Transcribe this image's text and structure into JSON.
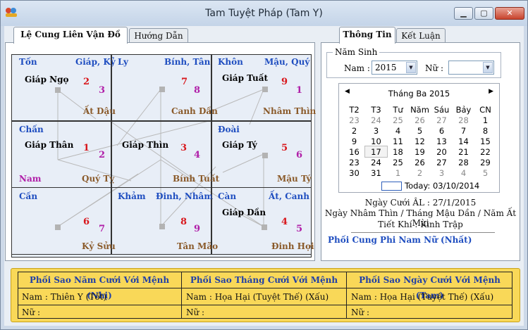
{
  "window": {
    "title": "Tam Tuyệt Pháp (Tam Y)"
  },
  "left_tabs": [
    {
      "label": "Lệ Cung Liên Vận Đồ"
    },
    {
      "label": "Hướng Dẫn"
    }
  ],
  "right_tabs": [
    {
      "label": "Thông Tin"
    },
    {
      "label": "Kết Luận"
    }
  ],
  "palaces": {
    "ton": {
      "name": "Tốn",
      "can": "Giáp, Kỷ",
      "gname": "Giáp Ngọ",
      "n1": "2",
      "n2": "3",
      "branch": "Ất Dậu"
    },
    "ly": {
      "name": "Ly",
      "can": "Bính, Tân",
      "gname": "",
      "n1": "7",
      "n2": "8",
      "branch": "Canh Dần"
    },
    "khon": {
      "name": "Khôn",
      "can": "Mậu, Quý",
      "gname": "Giáp Tuất",
      "n1": "9",
      "n2": "1",
      "branch": "Nhâm Thìn"
    },
    "chan": {
      "name": "Chấn",
      "can": "",
      "gname": "Giáp Thân",
      "n1": "1",
      "n2": "2",
      "branch": "Quý Tỵ",
      "extra": "Nam"
    },
    "center": {
      "name": "",
      "can": "",
      "gname": "Giáp Thìn",
      "n1": "3",
      "n2": "4",
      "branch": "Bính Tuất"
    },
    "doai": {
      "name": "Đoài",
      "can": "",
      "gname": "Giáp Tý",
      "n1": "5",
      "n2": "6",
      "branch": "Mậu Tý"
    },
    "can": {
      "name": "Cấn",
      "can": "",
      "gname": "",
      "n1": "6",
      "n2": "7",
      "branch": "Kỷ Sửu"
    },
    "kham": {
      "name": "Khảm",
      "can": "Đinh, Nhâm",
      "gname": "",
      "n1": "8",
      "n2": "9",
      "branch": "Tân Mão"
    },
    "canq": {
      "name": "Càn",
      "can": "Ất, Canh",
      "gname": "Giáp Dần",
      "n1": "4",
      "n2": "5",
      "branch": "Đinh Hợi"
    }
  },
  "birth": {
    "group_label": "Năm Sinh",
    "nam_label": "Nam :",
    "nam_value": "2015",
    "nu_label": "Nữ :",
    "nu_value": ""
  },
  "calendar": {
    "month_label": "Tháng Ba 2015",
    "weekdays": [
      "T2",
      "T3",
      "Tư",
      "Năm",
      "Sáu",
      "Bảy",
      "CN"
    ],
    "weeks": [
      [
        [
          "23",
          1
        ],
        [
          "24",
          1
        ],
        [
          "25",
          1
        ],
        [
          "26",
          1
        ],
        [
          "27",
          1
        ],
        [
          "28",
          1
        ],
        [
          "1",
          0
        ]
      ],
      [
        [
          "2",
          0
        ],
        [
          "3",
          0
        ],
        [
          "4",
          0
        ],
        [
          "5",
          0
        ],
        [
          "6",
          0
        ],
        [
          "7",
          0
        ],
        [
          "8",
          0
        ]
      ],
      [
        [
          "9",
          0
        ],
        [
          "10",
          0
        ],
        [
          "11",
          0
        ],
        [
          "12",
          0
        ],
        [
          "13",
          0
        ],
        [
          "14",
          0
        ],
        [
          "15",
          0
        ]
      ],
      [
        [
          "16",
          0
        ],
        [
          "17",
          2
        ],
        [
          "18",
          0
        ],
        [
          "19",
          0
        ],
        [
          "20",
          0
        ],
        [
          "21",
          0
        ],
        [
          "22",
          0
        ]
      ],
      [
        [
          "23",
          0
        ],
        [
          "24",
          0
        ],
        [
          "25",
          0
        ],
        [
          "26",
          0
        ],
        [
          "27",
          0
        ],
        [
          "28",
          0
        ],
        [
          "29",
          0
        ]
      ],
      [
        [
          "30",
          0
        ],
        [
          "31",
          0
        ],
        [
          "1",
          1
        ],
        [
          "2",
          1
        ],
        [
          "3",
          1
        ],
        [
          "4",
          1
        ],
        [
          "5",
          1
        ]
      ]
    ],
    "today_label": "Today: 03/10/2014"
  },
  "info": {
    "ngay_cuoi": "Ngày Cưới ÂL : 27/1/2015",
    "can_chi": "Ngày Nhâm Thìn / Tháng Mậu Dần / Năm Ất Mùi",
    "tiet_khi": "Tiết Khí : Kinh Trập",
    "phoi_cung": "Phối Cung Phi Nam Nữ (Nhất)"
  },
  "bottom": {
    "headers": [
      "Phối Sao Năm Cưới Với Mệnh (Nhị)",
      "Phối Sao Tháng Cưới Với Mệnh",
      "Phối Sao Ngày Cưới Với Mệnh (Tam)"
    ],
    "nam": [
      "Nam : Thiên Y (Tốt)",
      "Nam : Họa Hại (Tuyệt Thế) (Xấu)",
      "Nam : Họa Hại (Tuyệt Thế) (Xấu)"
    ],
    "nu": [
      "Nữ :",
      "Nữ :",
      "Nữ :"
    ]
  }
}
